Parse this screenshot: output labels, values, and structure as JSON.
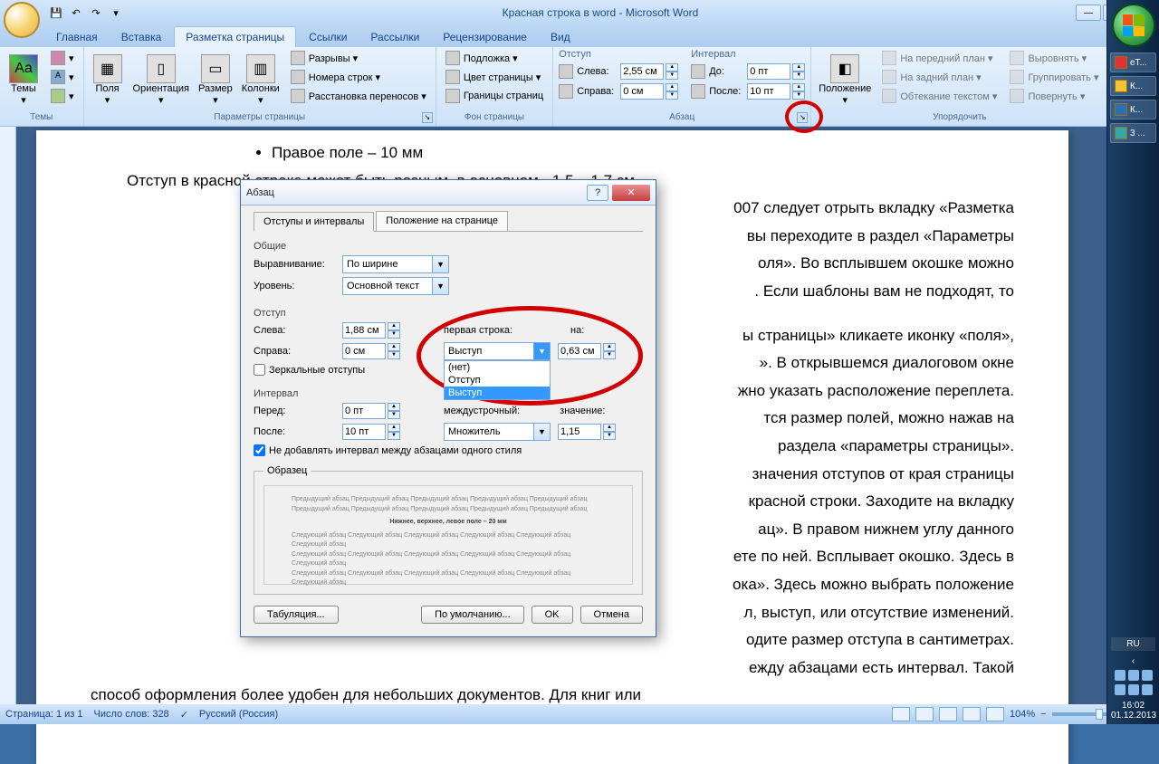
{
  "titlebar": {
    "title": "Красная строка в word - Microsoft Word"
  },
  "tabs": {
    "home": "Главная",
    "insert": "Вставка",
    "layout": "Разметка страницы",
    "references": "Ссылки",
    "mailings": "Рассылки",
    "review": "Рецензирование",
    "view": "Вид"
  },
  "ribbon": {
    "themes": {
      "label": "Темы",
      "btn": "Темы"
    },
    "page_setup": {
      "label": "Параметры страницы",
      "margins": "Поля",
      "orientation": "Ориентация",
      "size": "Размер",
      "columns": "Колонки",
      "breaks": "Разрывы ▾",
      "line_numbers": "Номера строк ▾",
      "hyphenation": "Расстановка переносов ▾"
    },
    "page_bg": {
      "label": "Фон страницы",
      "watermark": "Подложка ▾",
      "color": "Цвет страницы ▾",
      "borders": "Границы страниц"
    },
    "paragraph": {
      "label": "Абзац",
      "indent_hdr": "Отступ",
      "spacing_hdr": "Интервал",
      "left": "Слева:",
      "right": "Справа:",
      "before": "До:",
      "after": "После:",
      "left_val": "2,55 см",
      "right_val": "0 см",
      "before_val": "0 пт",
      "after_val": "10 пт"
    },
    "arrange": {
      "label": "Упорядочить",
      "position": "Положение",
      "front": "На передний план ▾",
      "back": "На задний план ▾",
      "wrap": "Обтекание текстом ▾",
      "align": "Выровнять ▾",
      "group": "Группировать ▾",
      "rotate": "Повернуть ▾"
    }
  },
  "document": {
    "bullet": "Правое поле – 10 мм",
    "l1": "Отступ в красной строке может быть разным, в основном  - 1,5 – 1,7 см.",
    "p1a": "007 следует отрыть вкладку «Разметка",
    "p1b": "вы переходите в раздел «Параметры",
    "p1c": "оля». Во всплывшем окошке можно",
    "p1d": ". Если шаблоны вам не подходят, то",
    "p2a": "ы страницы» кликаете иконку «поля»,",
    "p2b": "». В открывшемся диалоговом окне",
    "p2c": "жно указать расположение переплета.",
    "p2d": "тся размер полей, можно нажав на",
    "p2e": "раздела «параметры страницы».",
    "p3a": "значения отступов от края страницы",
    "p3b": "красной строки. Заходите на вкладку",
    "p3c": "ац».  В правом нижнем углу данного",
    "p3d": "ете по ней. Всплывает окошко. Здесь в",
    "p3e": "ока». Здесь можно выбрать положение",
    "p3f": "л, выступ, или отсутствие изменений.",
    "p3g": "одите размер отступа в сантиметрах.",
    "p4a": "ежду абзацами есть интервал.  Такой",
    "p4b": "способ оформления более удобен для небольших документов. Для книг или"
  },
  "dialog": {
    "title": "Абзац",
    "tab1": "Отступы и интервалы",
    "tab2": "Положение на странице",
    "general": "Общие",
    "alignment": "Выравнивание:",
    "alignment_val": "По ширине",
    "level": "Уровень:",
    "level_val": "Основной текст",
    "indent": "Отступ",
    "left": "Слева:",
    "left_val": "1,88 см",
    "right": "Справа:",
    "right_val": "0 см",
    "mirror": "Зеркальные отступы",
    "first_line": "первая строка:",
    "first_line_val": "Выступ",
    "by": "на:",
    "by_val": "0,63 см",
    "dd_none": "(нет)",
    "dd_indent": "Отступ",
    "dd_hang": "Выступ",
    "spacing": "Интервал",
    "before": "Перед:",
    "before_val": "0 пт",
    "after": "После:",
    "after_val": "10 пт",
    "line_spacing": "междустрочный:",
    "line_spacing_val": "Множитель",
    "value": "значение:",
    "value_val": "1,15",
    "no_space": "Не добавлять интервал между абзацами одного стиля",
    "preview": "Образец",
    "preview_line1": "Предыдущий абзац Предыдущий абзац Предыдущий абзац Предыдущий абзац Предыдущий абзац",
    "preview_line2": "Предыдущий абзац Предыдущий абзац Предыдущий абзац Предыдущий абзац Предыдущий абзац",
    "preview_sample": "Нижнее, верхнее, левое поле – 20 мм",
    "preview_line3": "Следующий абзац Следующий абзац Следующий абзац Следующий абзац Следующий абзац Следующий абзац",
    "preview_line4": "Следующий абзац Следующий абзац Следующий абзац Следующий абзац Следующий абзац Следующий абзац",
    "preview_line5": "Следующий абзац Следующий абзац Следующий абзац Следующий абзац Следующий абзац Следующий абзац",
    "tabs_btn": "Табуляция...",
    "default_btn": "По умолчанию...",
    "ok": "OK",
    "cancel": "Отмена"
  },
  "statusbar": {
    "page": "Страница: 1 из 1",
    "words": "Число слов: 328",
    "lang": "Русский (Россия)",
    "zoom": "104%"
  },
  "taskbar": {
    "items": [
      "eT...",
      "К...",
      "К...",
      "3 ..."
    ],
    "lang": "RU",
    "time": "16:02",
    "date": "01.12.2013"
  }
}
